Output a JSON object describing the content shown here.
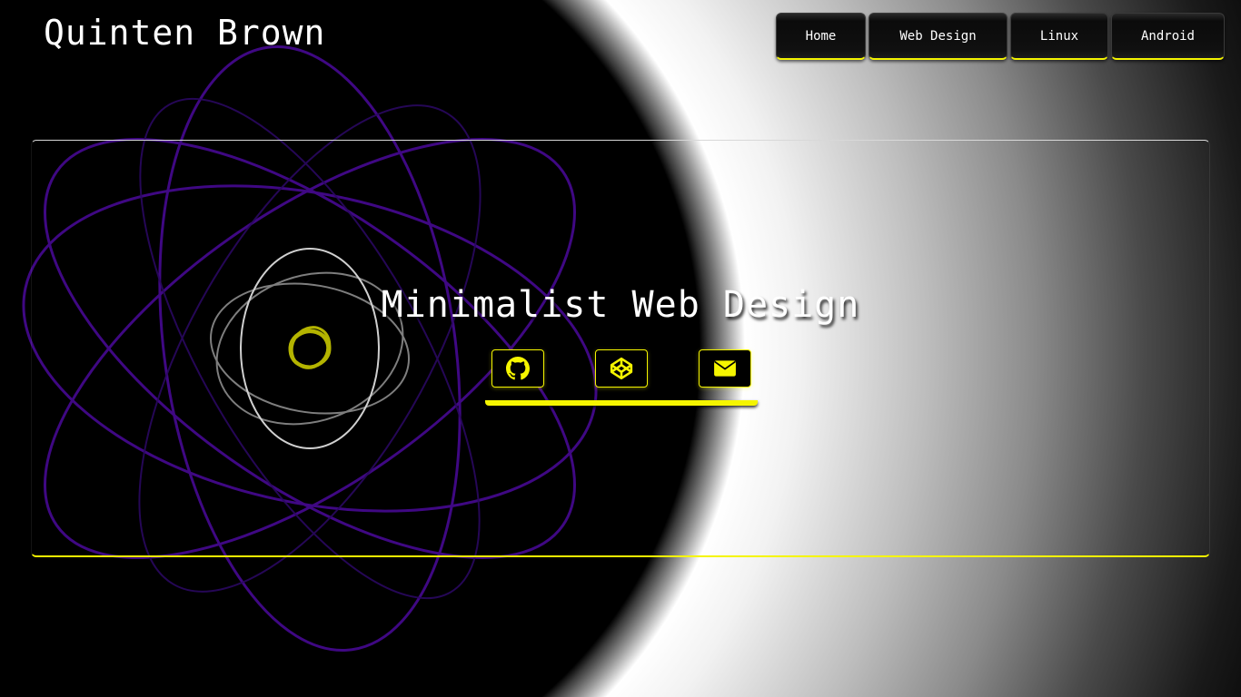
{
  "header": {
    "site_title": "Quinten Brown"
  },
  "nav": {
    "items": [
      {
        "label": "Home"
      },
      {
        "label": "Web Design"
      },
      {
        "label": "Linux"
      },
      {
        "label": "Android"
      }
    ]
  },
  "hero": {
    "title": "Minimalist Web Design",
    "social_icons": [
      {
        "icon": "github-icon"
      },
      {
        "icon": "codepen-icon"
      },
      {
        "icon": "envelope-icon"
      }
    ]
  },
  "colors": {
    "accent": "#f5f500",
    "orbit_purple": "#4a0a9a",
    "orbit_gray": "#b0b0b0",
    "background": "#000000",
    "text": "#ffffff"
  }
}
